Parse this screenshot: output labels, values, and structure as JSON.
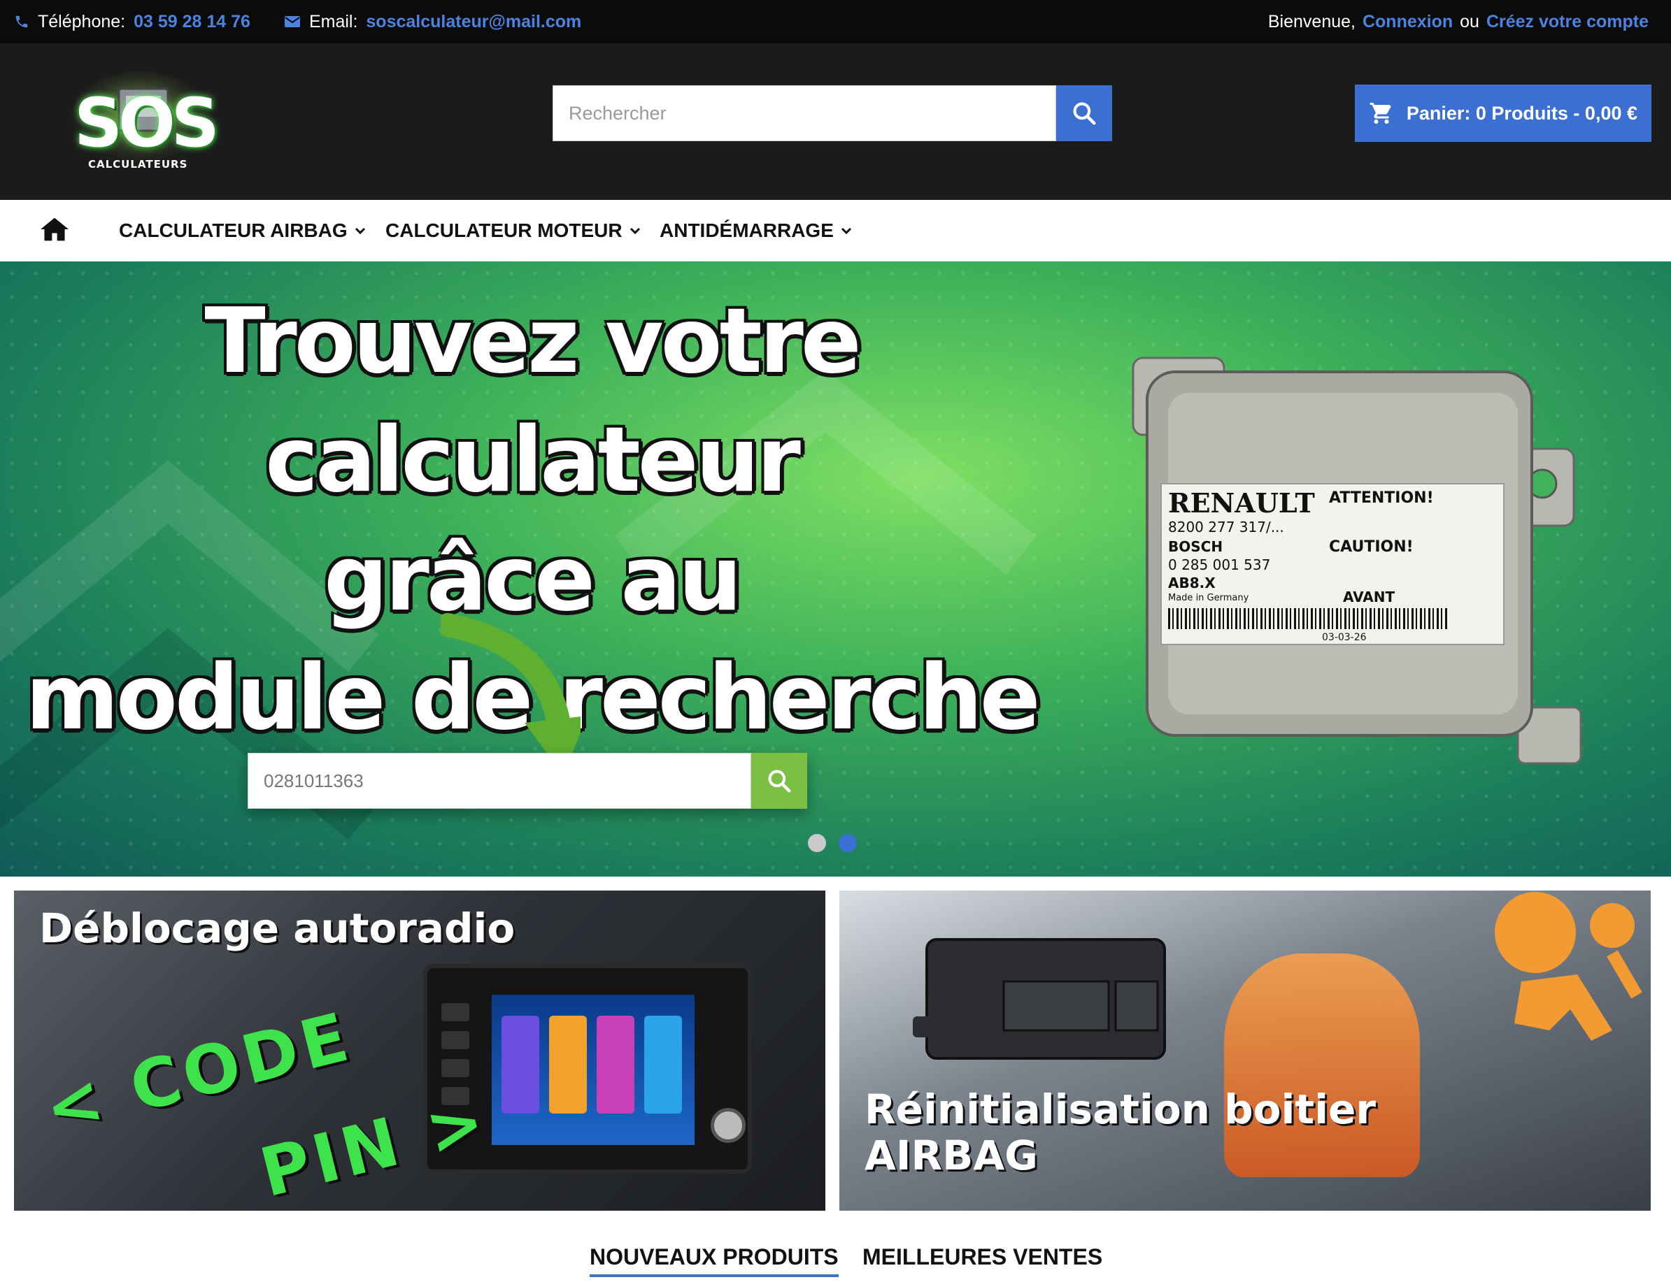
{
  "topbar": {
    "phone_label": "Téléphone:",
    "phone_value": "03 59 28 14 76",
    "email_label": "Email:",
    "email_value": "soscalculateur@mail.com",
    "welcome": "Bienvenue,",
    "login": "Connexion",
    "or": "ou",
    "create_account": "Créez votre compte"
  },
  "header": {
    "logo_text": "SOS",
    "logo_sub": "CALCULATEURS",
    "search_placeholder": "Rechercher",
    "cart_label": "Panier: 0 Produits - 0,00 €"
  },
  "nav": {
    "items": [
      {
        "label": "CALCULATEUR AIRBAG"
      },
      {
        "label": "CALCULATEUR MOTEUR"
      },
      {
        "label": "ANTIDÉMARRAGE"
      }
    ]
  },
  "hero": {
    "line1": "Trouvez votre calculateur",
    "line2": "grâce au",
    "line3": "module de recherche",
    "search_example": "0281011363",
    "ecu_brand": "RENAULT",
    "ecu_attention": "ATTENTION!",
    "ecu_ref1": "8200 277 317/...",
    "ecu_bosch": "BOSCH",
    "ecu_ref2": "0 285 001 537",
    "ecu_ref3": "AB8.X",
    "ecu_caution": "CAUTION!",
    "ecu_made": "Made in Germany",
    "ecu_avant": "AVANT",
    "ecu_date": "03-03-26",
    "slides": 2,
    "active_slide": 2
  },
  "banners": {
    "left_title": "Déblocage autoradio",
    "left_code1": "< CODE",
    "left_code2": "PIN >",
    "right_line1": "Réinitialisation boitier",
    "right_line2": "AIRBAG"
  },
  "tabs": {
    "new_products": "NOUVEAUX PRODUITS",
    "best_sellers": "MEILLEURES VENTES"
  },
  "colors": {
    "accent": "#3c6fd2",
    "topbar_bg": "#0b0b0b",
    "header_bg": "#1b1b1b",
    "hero_green": "#3fb25a",
    "search_green": "#7cc043"
  }
}
